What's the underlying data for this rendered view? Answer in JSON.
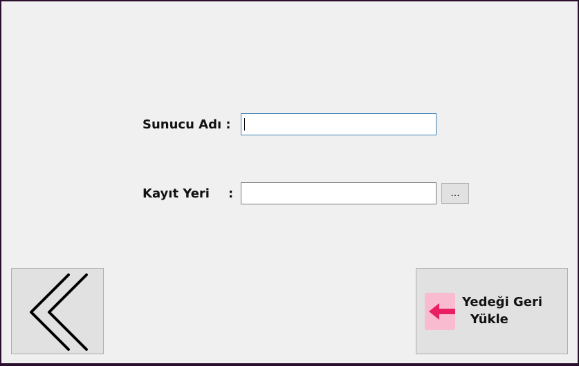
{
  "form": {
    "server_name_label": "Sunucu Adı :",
    "server_name_value": "",
    "save_location_label": "Kayıt Yeri",
    "save_location_colon": ":",
    "save_location_value": "",
    "browse_label": "..."
  },
  "buttons": {
    "back_icon": "double-chevron-left-icon",
    "restore_icon": "arrow-left-icon",
    "restore_label_line1": "Yedeği Geri",
    "restore_label_line2": "Yükle"
  },
  "colors": {
    "window_bg": "#f0f0f0",
    "frame": "#2a0f2e",
    "accent_pink": "#e91e63",
    "icon_bg_pink": "#f8bbd0",
    "focus_border": "#3c7fb1"
  }
}
